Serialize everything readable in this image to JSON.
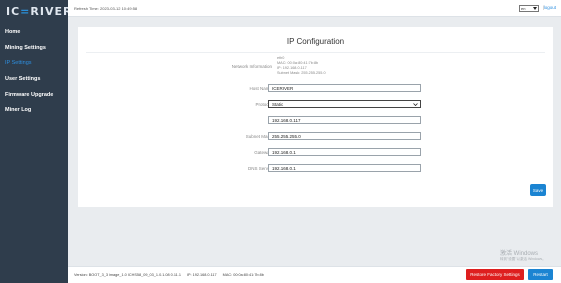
{
  "sidebar": {
    "logo": {
      "part1": "IC",
      "part2": "=",
      "part3": "RIVER"
    },
    "items": [
      {
        "label": "Home"
      },
      {
        "label": "Mining Settings"
      },
      {
        "label": "IP Settings"
      },
      {
        "label": "User Settings"
      },
      {
        "label": "Firmware Upgrade"
      },
      {
        "label": "Miner Log"
      }
    ],
    "active_index": 2
  },
  "topbar": {
    "refresh_text": "Refresh Time: 2023-03-12 10:49:58",
    "language_value": "en",
    "separator": "|",
    "logout_label": "logout"
  },
  "card": {
    "title": "IP Configuration",
    "network_info_label": "Network Information",
    "network_info_lines": [
      "eth0",
      "MAC: 00:0a:80:41:7b:8b",
      "IP: 192.168.0.117",
      "Subnet Mask: 255.255.255.0"
    ],
    "fields": {
      "host_name": {
        "label": "Host Name",
        "value": "ICERIVER"
      },
      "protocol": {
        "label": "Protocol",
        "value": "Static"
      },
      "ip": {
        "label": "IP",
        "value": "192.168.0.117"
      },
      "subnet_mask": {
        "label": "Subnet Mask",
        "value": "255.255.255.0"
      },
      "gateway": {
        "label": "Gateway",
        "value": "192.168.0.1"
      },
      "dns_server": {
        "label": "DNS Server",
        "value": "192.168.0.1"
      }
    },
    "save_label": "Save"
  },
  "footer": {
    "version_text": "Version: BOOT_3_3 image_1.0 ICHS58_09_03_1.0.1.08 0.11.1 ",
    "ip_text": "IP: 192.168.0.117",
    "mac_text": "MAC: 00:0a:80:41:7b:8b",
    "restore_label": "Restore Factory Settings",
    "restart_label": "Restart"
  },
  "watermark": {
    "line1": "激活 Windows",
    "line2": "转到\"设置\"以激活 Windows。"
  },
  "colors": {
    "sidebar_bg": "#2f3d4c",
    "accent_blue": "#1b84d2",
    "danger_red": "#de1f1f",
    "active_nav": "#2d8fe0"
  },
  "icons": {
    "select_caret": "chevron-down-icon"
  }
}
